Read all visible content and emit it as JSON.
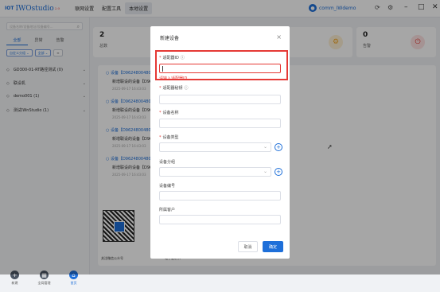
{
  "app": {
    "name": "IWOstudio",
    "version": "2.0",
    "brand_mark": "IOT",
    "menu": [
      "联网设置",
      "配置工具",
      "本地设置"
    ],
    "active_menu": 2,
    "user": "comm_IWdemo"
  },
  "sidebar": {
    "search_placeholder": "设备名称/设备地址/设备编号...",
    "tabs": [
      "全部",
      "异常",
      "告警"
    ],
    "filters": [
      "自定义分组",
      "全部"
    ],
    "groups": [
      "GD300-01-RT路径测试 (0)",
      "联设机",
      "demo001 (1)",
      "测试IWnStudio (1)"
    ]
  },
  "bottomnav": [
    {
      "label": "新建",
      "icon": "add-icon"
    },
    {
      "label": "全局管理",
      "icon": "grid-icon"
    },
    {
      "label": "首页",
      "icon": "home-icon"
    }
  ],
  "stats": [
    {
      "num": "2",
      "label": "总数"
    },
    {
      "num": "0",
      "label": "告警"
    }
  ],
  "feed": [
    {
      "title": "设备【D9624800480",
      "desc": "新增联设的设备【D9624",
      "time": "2025-09-17 16:43:03"
    },
    {
      "title": "设备【D9624800480",
      "desc": "新增联设的设备【D9624",
      "time": "2025-09-17 16:43:03"
    },
    {
      "title": "设备【D9624800480",
      "desc": "新增联设的设备【D9624",
      "time": "2025-09-17 16:43:03"
    },
    {
      "title": "设备【D9624800480",
      "desc": "新增联设的设备【D9624",
      "time": "2025-09-17 16:43:03"
    }
  ],
  "qr": {
    "left_label": "关注微信公众号",
    "right_label": "电子说明书"
  },
  "dialog": {
    "title": "新建设备",
    "fields": [
      {
        "label": "适配器ID",
        "required": true,
        "help": true,
        "value": ""
      },
      {
        "label": "适配器秘钥",
        "required": true,
        "help": true,
        "value": ""
      },
      {
        "label": "设备名称",
        "required": true,
        "help": false,
        "value": ""
      },
      {
        "label": "设备类型",
        "required": true,
        "help": false,
        "value": "",
        "select": true
      },
      {
        "label": "设备分组",
        "required": false,
        "help": false,
        "value": "",
        "select": true
      },
      {
        "label": "设备编号",
        "required": false,
        "help": false,
        "value": ""
      },
      {
        "label": "所属客户",
        "required": false,
        "help": false,
        "value": ""
      }
    ],
    "error": "请输入适配器ID",
    "cancel": "取消",
    "ok": "确定"
  },
  "colors": {
    "accent": "#1e6fd9",
    "error": "#e53935",
    "warning": "#f5a623"
  }
}
